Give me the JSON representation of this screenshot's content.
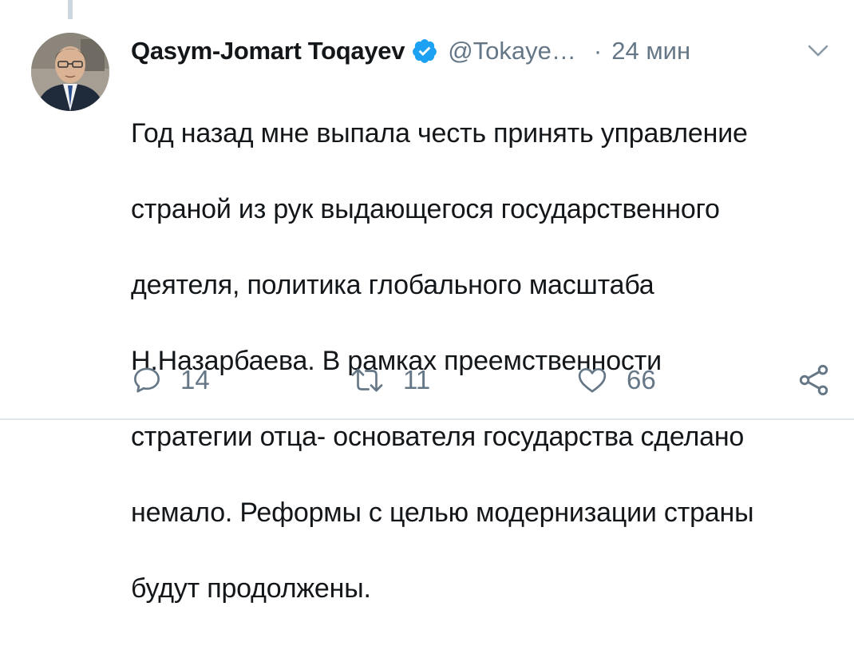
{
  "tweet": {
    "author": {
      "display_name": "Qasym-Jomart Toqayev",
      "handle": "@Tokaye…",
      "verified": true
    },
    "separator": "·",
    "time": "24 мин",
    "text_lines": [
      "Год назад мне выпала честь принять управление",
      "страной из рук выдающегося государственного",
      "деятеля, политика глобального масштаба",
      "Н.Назарбаева. В рамках преемственности",
      "стратегии отца- основателя государства сделано",
      "немало. Реформы с целью модернизации страны",
      "будут продолжены."
    ],
    "actions": {
      "reply_count": "14",
      "retweet_count": "11",
      "like_count": "66"
    }
  },
  "icons": {
    "reply": "reply-icon",
    "retweet": "retweet-icon",
    "like": "heart-icon",
    "share": "share-icon",
    "verified": "verified-badge-icon",
    "caret": "chevron-down-icon"
  },
  "colors": {
    "text": "#14171a",
    "secondary": "#657786",
    "verified_blue": "#1da1f2",
    "divider": "#e1e8ed"
  }
}
